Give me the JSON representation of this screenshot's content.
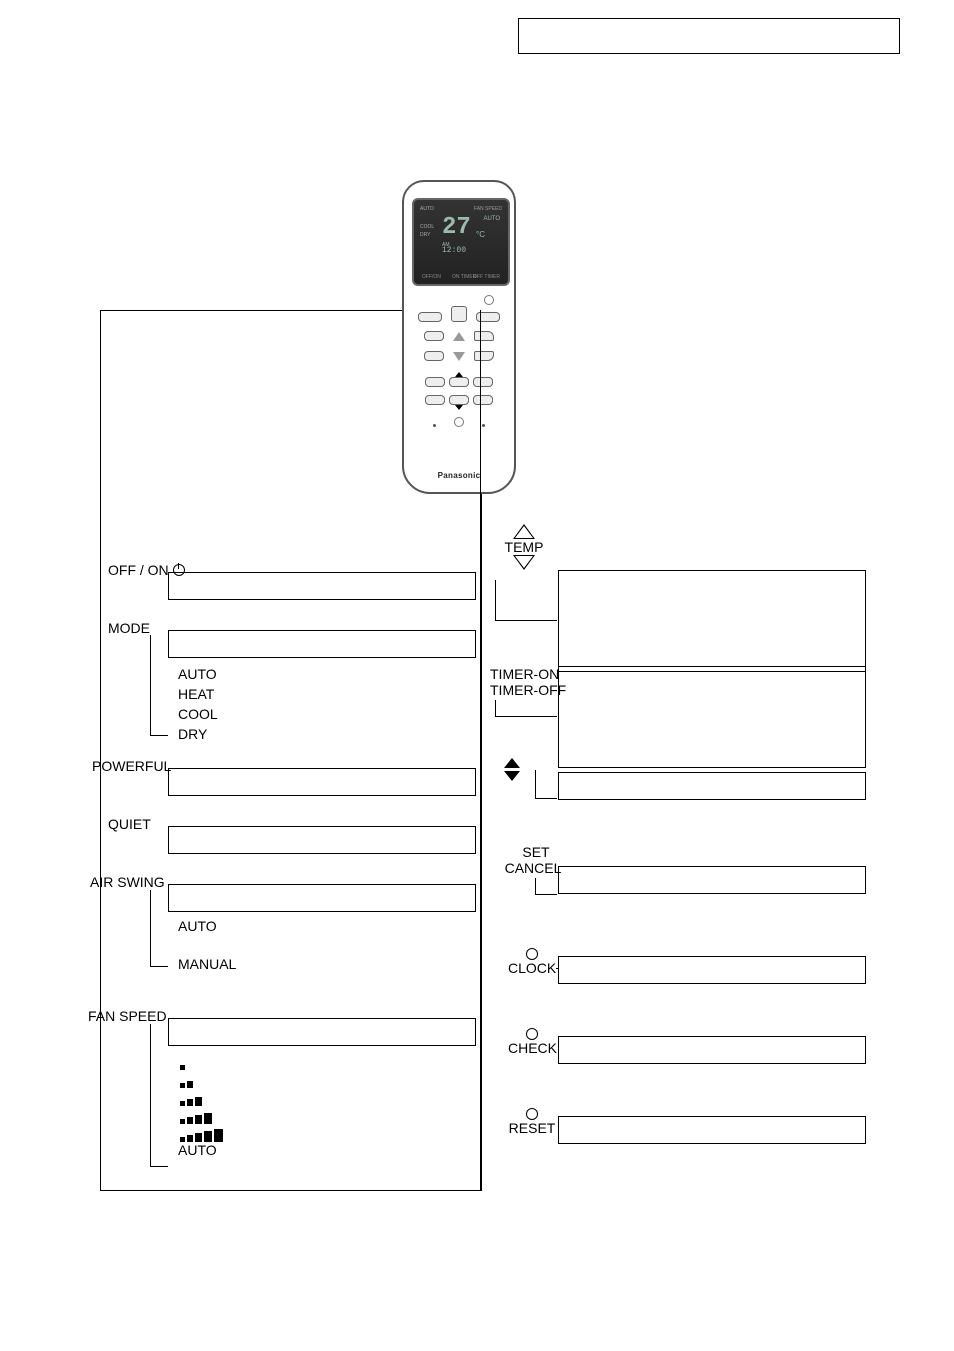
{
  "brand": "Panasonic",
  "lcd": {
    "topleft": "AUTO",
    "topright": "FAN SPEED",
    "leftcol1": "COOL",
    "leftcol2": "DRY",
    "temp": "27",
    "unit": "°C",
    "fanmode": "AUTO",
    "ampm": "AM",
    "clock": "12:00",
    "offon": "OFF/ON",
    "ontimer": "ON    TIMER",
    "offtimer": "OFF    TIMER"
  },
  "left": {
    "offon": "OFF / ON",
    "mode": "MODE",
    "mode_opts": [
      "AUTO",
      "HEAT",
      "COOL",
      "DRY"
    ],
    "powerful": "POWERFUL",
    "quiet": "QUIET",
    "airswing": "AIR SWING",
    "airswing_opts": [
      "AUTO",
      "MANUAL"
    ],
    "fanspeed": "FAN SPEED",
    "fan_auto": "AUTO"
  },
  "right": {
    "temp": "TEMP",
    "timeron": "TIMER-ON",
    "timeroff": "TIMER-OFF",
    "set": "SET",
    "cancel": "CANCEL",
    "clock": "CLOCK",
    "check": "CHECK",
    "reset": "RESET"
  }
}
